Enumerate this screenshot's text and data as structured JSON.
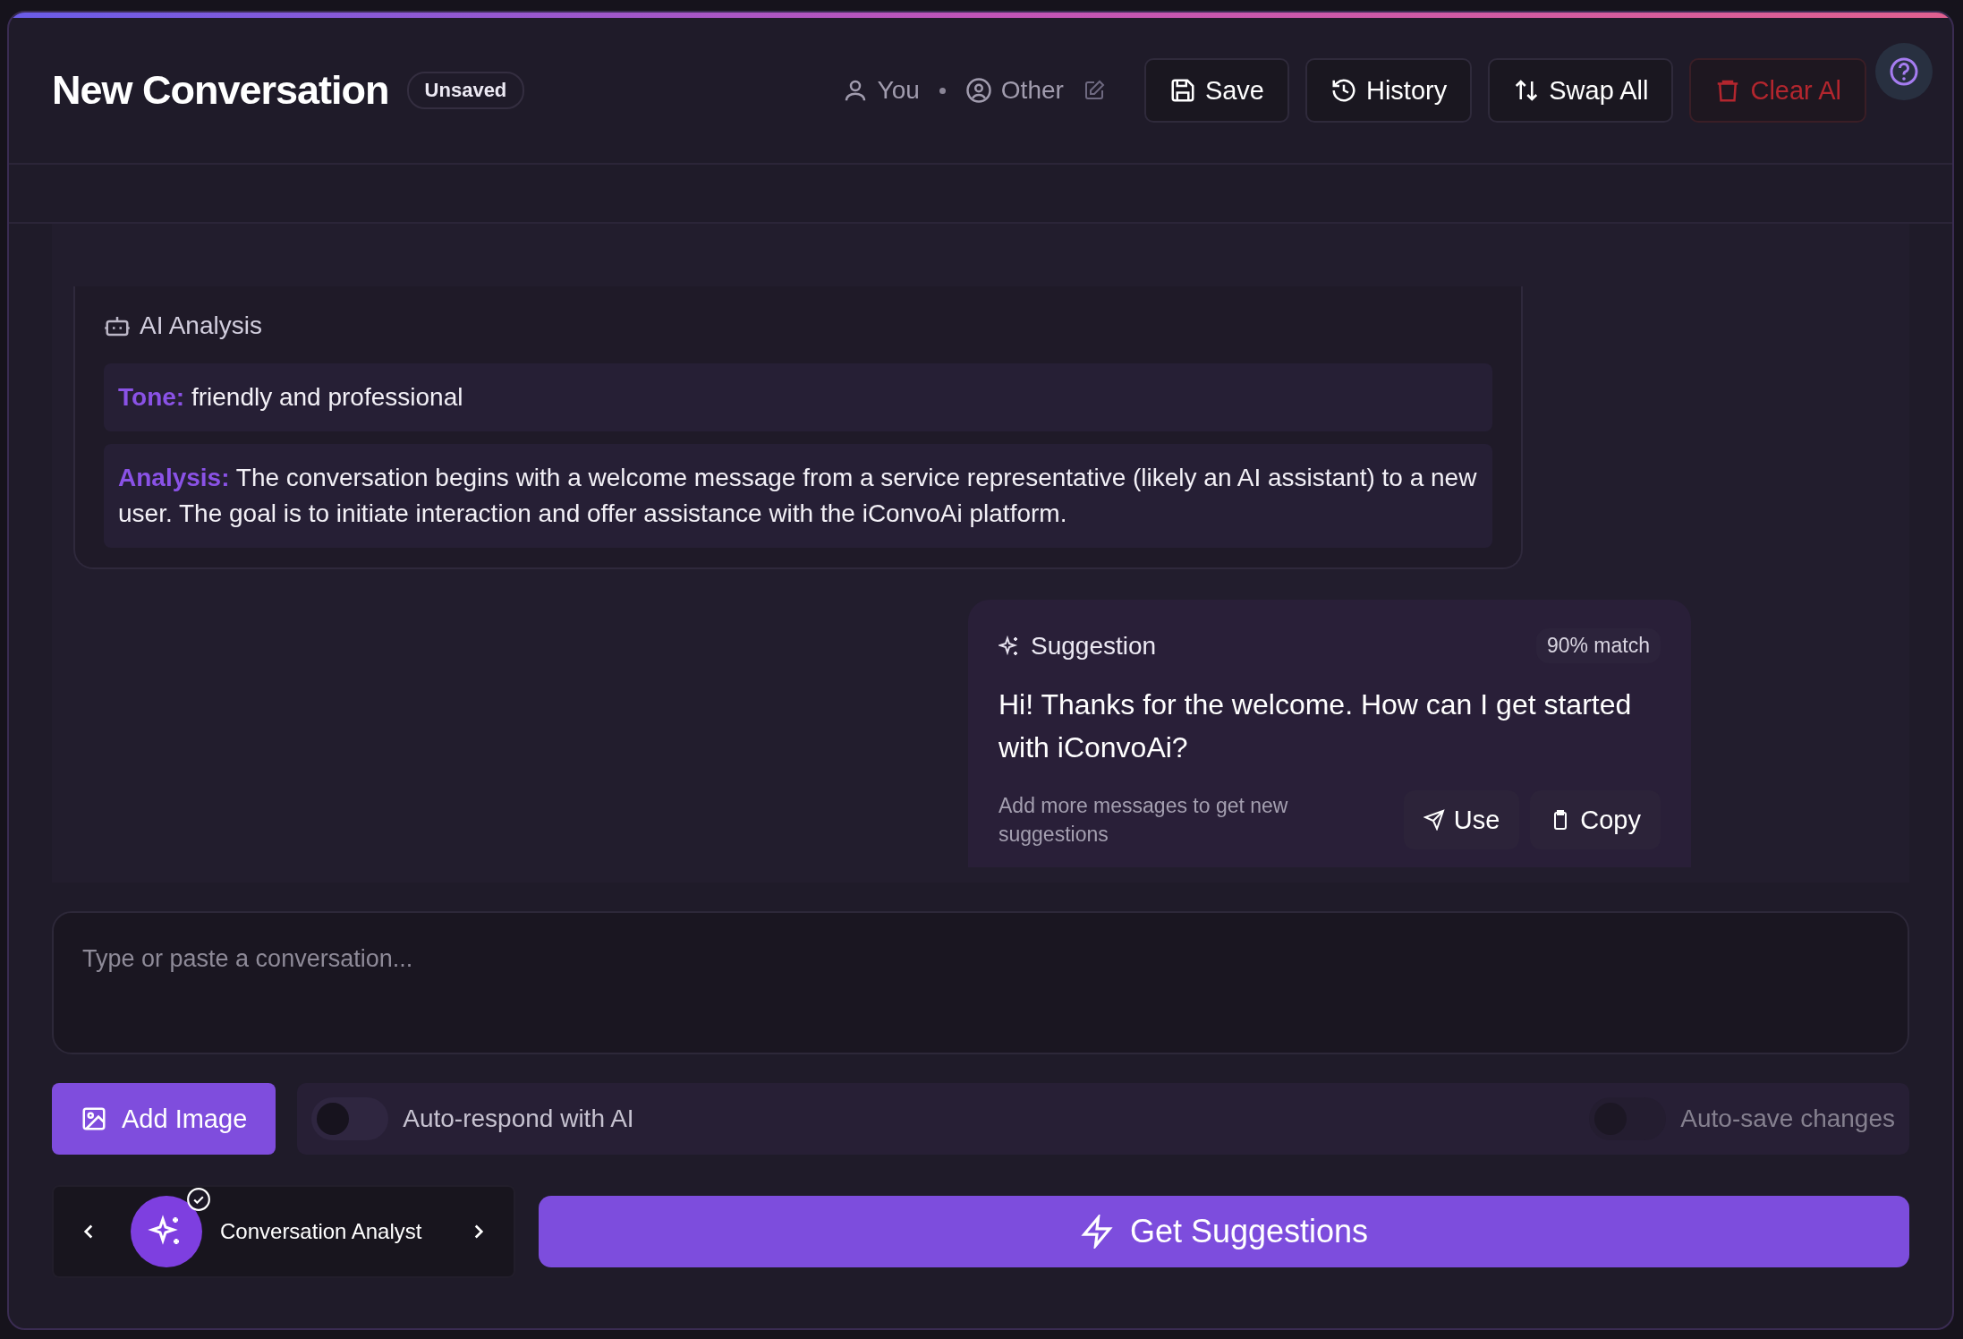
{
  "header": {
    "title": "New Conversation",
    "badge": "Unsaved",
    "participants": [
      {
        "label": "You",
        "kind": "person"
      },
      {
        "label": "Other",
        "kind": "circle"
      }
    ],
    "buttons": [
      {
        "label": "Save",
        "kind": "save",
        "danger": false
      },
      {
        "label": "History",
        "kind": "history",
        "danger": false
      },
      {
        "label": "Swap All",
        "kind": "swap",
        "danger": false
      },
      {
        "label": "Clear Al",
        "kind": "trash",
        "danger": true
      }
    ]
  },
  "analysis": {
    "title": "AI Analysis",
    "rows": [
      {
        "label": "Tone:",
        "text": "friendly and professional"
      },
      {
        "label": "Analysis:",
        "text": "The conversation begins with a welcome message from a service representative (likely an AI assistant) to a new user. The goal is to initiate interaction and offer assistance with the iConvoAi platform."
      }
    ]
  },
  "suggestion": {
    "title": "Suggestion",
    "match": "90% match",
    "text": "Hi! Thanks for the welcome. How can I get started with iConvoAi?",
    "hint": "Add more messages to get new suggestions",
    "actions": [
      {
        "label": "Use",
        "kind": "send"
      },
      {
        "label": "Copy",
        "kind": "copy"
      }
    ]
  },
  "input": {
    "placeholder": "Type or paste a conversation..."
  },
  "add_image": "Add Image",
  "toggles": [
    {
      "label": "Auto-respond with AI",
      "on": false,
      "disabled": false
    },
    {
      "label": "Auto-save changes",
      "on": false,
      "disabled": true
    }
  ],
  "assistant": {
    "name": "Conversation Analyst",
    "selected": true
  },
  "primary": "Get Suggestions"
}
